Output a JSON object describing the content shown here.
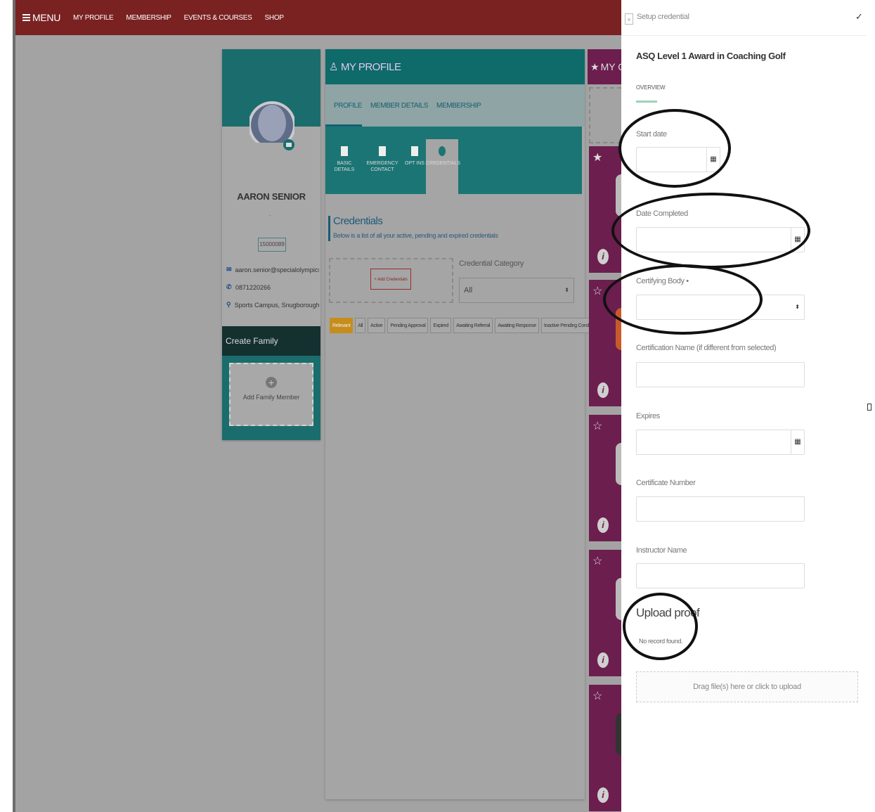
{
  "topbar": {
    "menu_label": "MENU",
    "nav": [
      "MY PROFILE",
      "MEMBERSHIP",
      "EVENTS & COURSES",
      "SHOP"
    ]
  },
  "profile": {
    "name": "AARON SENIOR",
    "separator": "-",
    "member_id": "15000089",
    "email": "aaron.senior@specialolympics.ie",
    "phone": "0871220266",
    "address": "Sports Campus, Snugborough Roa...",
    "create_family": "Create Family",
    "add_family_member": "Add Family Member"
  },
  "my_profile": {
    "title": "MY PROFILE",
    "tabs": [
      "PROFILE",
      "MEMBER DETAILS",
      "MEMBERSHIP"
    ],
    "active_tab": "PROFILE",
    "sub_tabs": [
      {
        "label": "BASIC DETAILS",
        "icon": "person-icon"
      },
      {
        "label": "EMERGENCY CONTACT",
        "icon": "contact-card-icon"
      },
      {
        "label": "OPT INS",
        "icon": "list-icon"
      },
      {
        "label": "CREDENTIALS",
        "icon": "badge-icon",
        "active": true
      }
    ],
    "credentials_title": "Credentials",
    "credentials_subtitle": "Below is a list of all your active, pending and expired credentials",
    "add_credentials": "+ Add Credentials",
    "category_label": "Credential Category",
    "category_value": "All",
    "filters": [
      "Relevant",
      "All",
      "Active",
      "Pending Approval",
      "Expired",
      "Awaiting Referral",
      "Awaiting Response",
      "Inactive Pending Conditions"
    ],
    "active_filter": "Relevant"
  },
  "right_column": {
    "title": "MY CL"
  },
  "side_panel": {
    "title": "Setup credential",
    "save_label": "✓",
    "award": "ASQ Level 1 Award in Coaching Golf",
    "overview_tab": "OVERVIEW",
    "fields": {
      "start_date": "Start date",
      "date_completed": "Date Completed",
      "certifying_body": "Certifying Body",
      "certification_name": "Certification Name (if different from selected)",
      "expires": "Expires",
      "certificate_number": "Certificate Number",
      "instructor_name": "Instructor Name"
    },
    "required_mark": "•",
    "upload_title": "Upload proof",
    "no_record": "No record found.",
    "dropzone": "Drag file(s) here or click to upload"
  },
  "colors": {
    "topbar": "#7a2121",
    "teal": "#1a6d6c",
    "purple": "#6c1e4e",
    "filter_active": "#c68d1c"
  }
}
